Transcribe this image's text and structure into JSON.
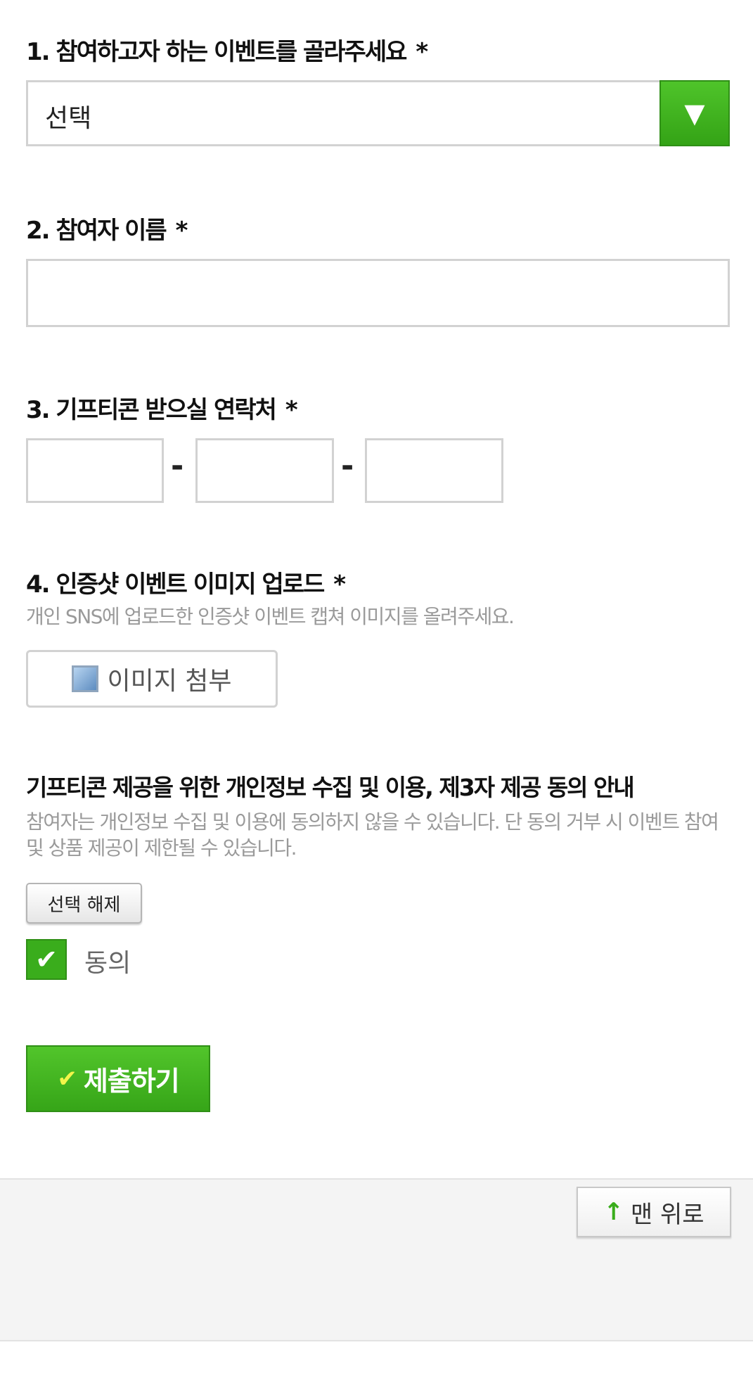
{
  "q1": {
    "label": "1. 참여하고자 하는 이벤트를 골라주세요",
    "required": "*",
    "selected": "선택",
    "arrow": "▼"
  },
  "q2": {
    "label": "2. 참여자 이름",
    "required": "*",
    "value": ""
  },
  "q3": {
    "label": "3. 기프티콘 받으실 연락처",
    "required": "*",
    "separator": "-"
  },
  "q4": {
    "label": "4. 인증샷 이벤트 이미지 업로드",
    "required": "*",
    "hint": "개인 SNS에 업로드한 인증샷 이벤트 캡쳐 이미지를 올려주세요.",
    "upload_label": "이미지 첨부"
  },
  "consent": {
    "title": "기프티콘 제공을 위한 개인정보 수집 및 이용, 제3자 제공 동의 안내",
    "description": "참여자는 개인정보 수집 및 이용에 동의하지 않을 수 있습니다. 단 동의 거부 시 이벤트 참여 및 상품 제공이 제한될 수 있습니다.",
    "deselect_label": "선택 해제",
    "checkbox_checked": true,
    "agree_label": "동의"
  },
  "submit": {
    "label": "제출하기",
    "check": "✔"
  },
  "footer": {
    "top_button_label": "맨 위로",
    "top_icon": "↑"
  },
  "colors": {
    "accent": "#3aad1c",
    "accent_dark": "#2f8f16",
    "hint": "#9a9a9a"
  }
}
